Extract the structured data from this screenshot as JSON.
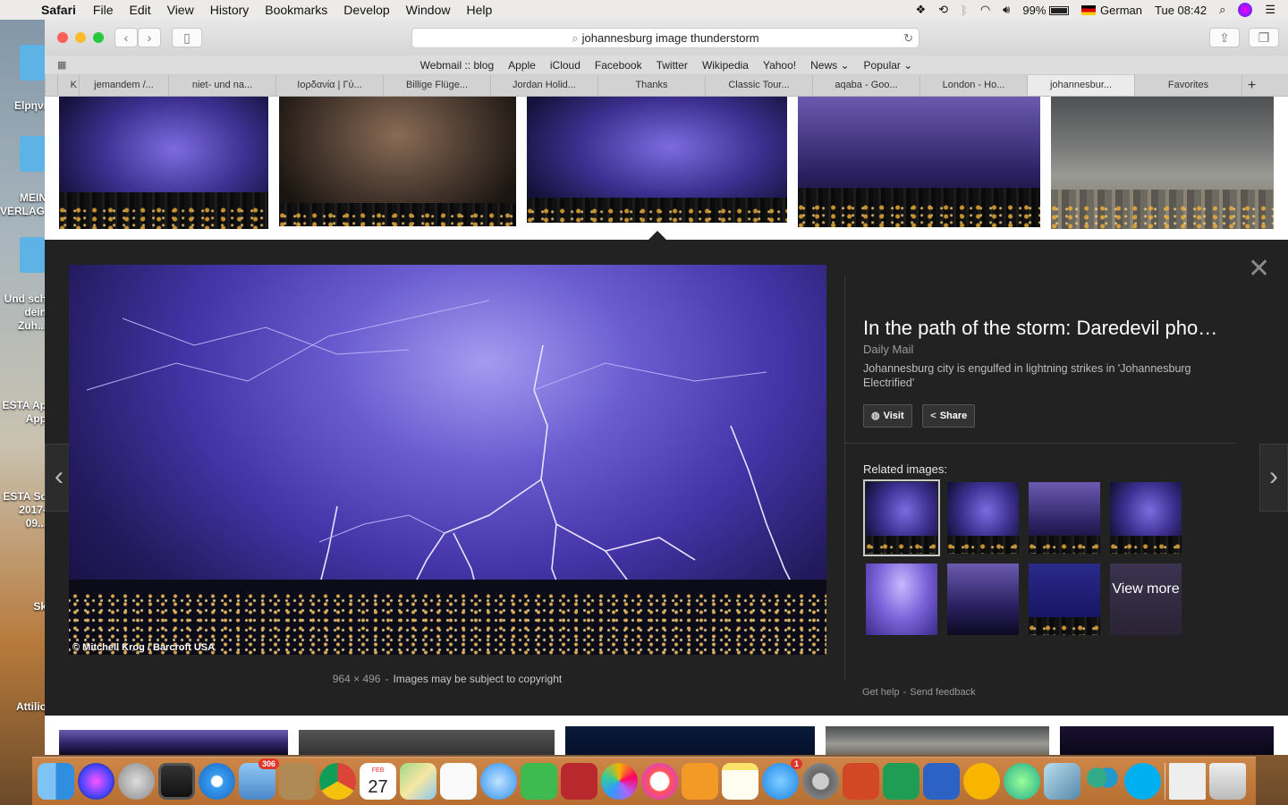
{
  "menubar": {
    "app_name": "Safari",
    "items": [
      "File",
      "Edit",
      "View",
      "History",
      "Bookmarks",
      "Develop",
      "Window",
      "Help"
    ],
    "battery": "99%",
    "input_language": "German",
    "clock": "Tue 08:42"
  },
  "desktop": {
    "labels": [
      "Elpηνι",
      "MEIN VERLAG...",
      "Und sch dein Zuh...",
      "ESTA Ap App",
      "ESTA Sc 2017-09...",
      "Sk",
      "Attilio"
    ]
  },
  "browser": {
    "url": "johannesburg image thunderstorm",
    "favorites": [
      "Webmail :: blog",
      "Apple",
      "iCloud",
      "Facebook",
      "Twitter",
      "Wikipedia",
      "Yahoo!",
      "News",
      "Popular"
    ],
    "tabs": [
      "K",
      "jemandem /...",
      "niet- und na...",
      "Ιορδανία | Γύ...",
      "Billige Flüge...",
      "Jordan Holid...",
      "Thanks",
      "Classic Tour...",
      "aqaba - Goo...",
      "London - Ho...",
      "johannesbur...",
      "Favorites"
    ]
  },
  "preview": {
    "title": "In the path of the storm: Daredevil pho…",
    "source": "Daily Mail",
    "description": "Johannesburg city is engulfed in lightning strikes in 'Johannesburg Electrified'",
    "visit_label": "Visit",
    "share_label": "Share",
    "image_credit": "© Mitchell Krog / Barcroft USA",
    "dimensions": "964 × 496",
    "copyright_note": "Images may be subject to copyright",
    "related_heading": "Related images:",
    "view_more_label": "View more",
    "help_label": "Get help",
    "feedback_label": "Send feedback"
  },
  "dock": {
    "mail_badge": "306",
    "appstore_badge": "1",
    "calendar_month": "FEB",
    "calendar_day": "27"
  },
  "colors": {
    "panel_bg": "#222222",
    "lightning_purple": "#6a5cd0",
    "close_red": "#fc5f57",
    "minimize_yellow": "#fdbc2e",
    "zoom_green": "#28c840"
  }
}
